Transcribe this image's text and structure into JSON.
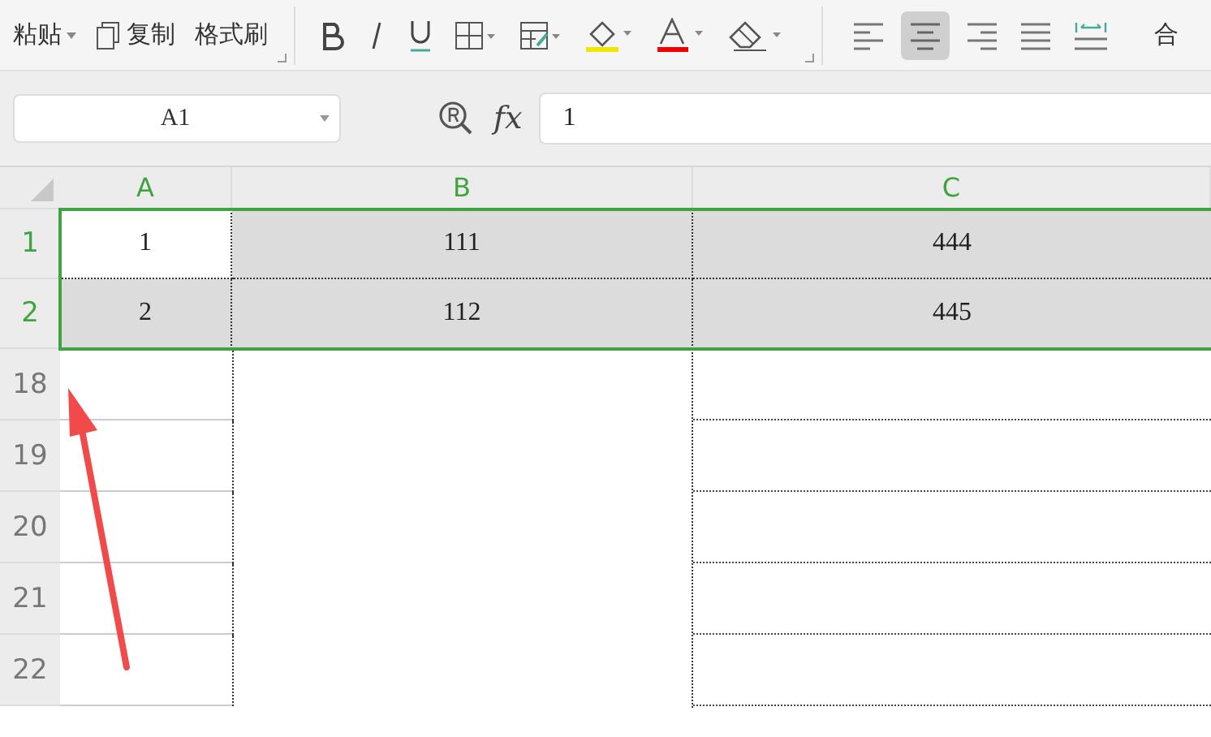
{
  "toolbar": {
    "clipboard": [
      {
        "kind": "paste",
        "label": "粘贴"
      },
      {
        "kind": "copy",
        "label": "复制"
      },
      {
        "kind": "format",
        "label": "格式刷"
      }
    ],
    "align_buttons": [
      {
        "kind": "left",
        "selected": false
      },
      {
        "kind": "center",
        "selected": true
      },
      {
        "kind": "right",
        "selected": false
      },
      {
        "kind": "justify",
        "selected": false
      },
      {
        "kind": "distributed",
        "selected": false
      }
    ],
    "merge_label": "合"
  },
  "formula_bar": {
    "name_box": "A1",
    "fx_label": "fx",
    "value": "1"
  },
  "sheet": {
    "columns": [
      {
        "label": "A",
        "selected": true
      },
      {
        "label": "B",
        "selected": true
      },
      {
        "label": "C",
        "selected": true
      }
    ],
    "rows": [
      {
        "label": "1",
        "selected": true,
        "cells": [
          {
            "value": "1",
            "active": true
          },
          {
            "value": "111",
            "active": false
          },
          {
            "value": "444",
            "active": false
          }
        ]
      },
      {
        "label": "2",
        "selected": true,
        "cells": [
          {
            "value": "2",
            "active": false
          },
          {
            "value": "112",
            "active": false
          },
          {
            "value": "445",
            "active": false
          }
        ]
      },
      {
        "label": "18",
        "selected": false,
        "cells": []
      },
      {
        "label": "19",
        "selected": false,
        "cells": []
      },
      {
        "label": "20",
        "selected": false,
        "cells": []
      },
      {
        "label": "21",
        "selected": false,
        "cells": []
      },
      {
        "label": "22",
        "selected": false,
        "cells": []
      }
    ]
  }
}
